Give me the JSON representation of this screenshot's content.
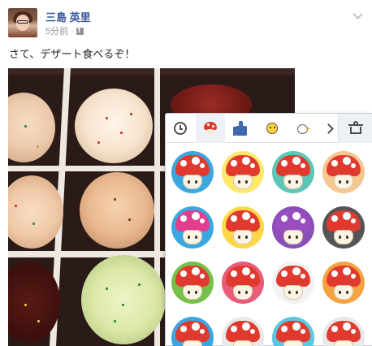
{
  "post": {
    "author": "三島 英里",
    "time": "5分前 ·",
    "text": "さて、デザート食べるぞ！"
  },
  "icons": {
    "options": "chevron-down-icon",
    "privacy": "facebook-icon"
  },
  "sticker_panel": {
    "tabs": [
      {
        "name": "recent",
        "icon": "clock-icon"
      },
      {
        "name": "mushroom-pack",
        "icon": "mushroom-icon",
        "active": true
      },
      {
        "name": "like-pack",
        "icon": "thumbs-up-icon"
      },
      {
        "name": "character-pack",
        "icon": "character-icon"
      },
      {
        "name": "bird-pack",
        "icon": "bird-icon"
      }
    ],
    "more": "chevron-right-icon",
    "store": "sticker-store-icon",
    "sticker_colors": [
      "#3aa8e0",
      "#ffe86b",
      "#5cc7b7",
      "#f6c78f",
      "#3aa8e0",
      "#ffd84a",
      "#8a4fb8",
      "#555555",
      "#76c04a",
      "#e85c7a",
      "#f2f2f2",
      "#f3a33f",
      "#3aa8e0",
      "#e8e8e8",
      "#5cc7e0",
      "#e8e8e8"
    ],
    "cap_colors": [
      "#e03a2f",
      "#e03a2f",
      "#e03a2f",
      "#e03a2f",
      "#e23d8e",
      "#e03a2f",
      "#9a4fc0",
      "#e03a2f",
      "#e03a2f",
      "#e03a2f",
      "#e03a2f",
      "#e03a2f",
      "#e03a2f",
      "#e03a2f",
      "#e03a2f",
      "#e03a2f"
    ]
  },
  "colors": {
    "link": "#365899",
    "meta": "#90949c",
    "brand": "#4267b2"
  }
}
